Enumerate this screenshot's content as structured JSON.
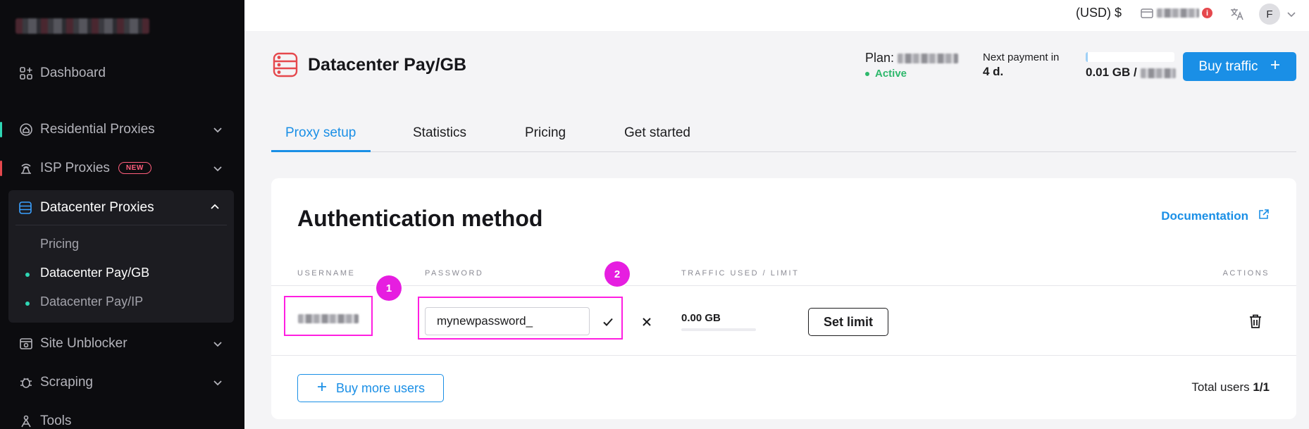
{
  "sidebar": {
    "items": [
      {
        "label": "Dashboard",
        "icon": "dashboard-icon"
      },
      {
        "label": "Residential Proxies",
        "icon": "residential-icon"
      },
      {
        "label": "ISP Proxies",
        "icon": "isp-icon",
        "badge": "NEW"
      },
      {
        "label": "Datacenter Proxies",
        "icon": "datacenter-icon",
        "expanded": true,
        "subitems": [
          {
            "label": "Pricing"
          },
          {
            "label": "Datacenter Pay/GB",
            "active": true
          },
          {
            "label": "Datacenter Pay/IP"
          }
        ]
      },
      {
        "label": "Site Unblocker",
        "icon": "site-unblocker-icon"
      },
      {
        "label": "Scraping",
        "icon": "scraping-icon"
      },
      {
        "label": "Tools",
        "icon": "tools-icon"
      }
    ]
  },
  "topbar": {
    "currency": "(USD) $",
    "avatar_letter": "F"
  },
  "header": {
    "title": "Datacenter Pay/GB",
    "plan_label": "Plan:",
    "status": "Active",
    "next_payment_label": "Next payment in",
    "next_payment_value": "4 d.",
    "traffic_value": "0.01 GB /",
    "traffic_fraction": 0.02,
    "buy_traffic_label": "Buy traffic"
  },
  "tabs": [
    {
      "label": "Proxy setup",
      "active": true
    },
    {
      "label": "Statistics"
    },
    {
      "label": "Pricing"
    },
    {
      "label": "Get started"
    }
  ],
  "auth": {
    "title": "Authentication method",
    "documentation_label": "Documentation",
    "columns": {
      "username": "USERNAME",
      "password": "PASSWORD",
      "traffic": "TRAFFIC USED / LIMIT",
      "actions": "ACTIONS"
    },
    "row": {
      "password_value": "mynewpassword_",
      "traffic_used": "0.00 GB",
      "set_limit_label": "Set limit"
    },
    "buy_more_users_label": "Buy more users",
    "total_users_label": "Total users",
    "total_users_value": "1/1",
    "annotations": [
      "1",
      "2"
    ]
  },
  "colors": {
    "accent": "#1a8fe6",
    "sidebar_bg": "#0c0c0f",
    "highlight": "#ff1fe1",
    "active_green": "#2eb86c",
    "new_badge": "#ff5e7c"
  }
}
